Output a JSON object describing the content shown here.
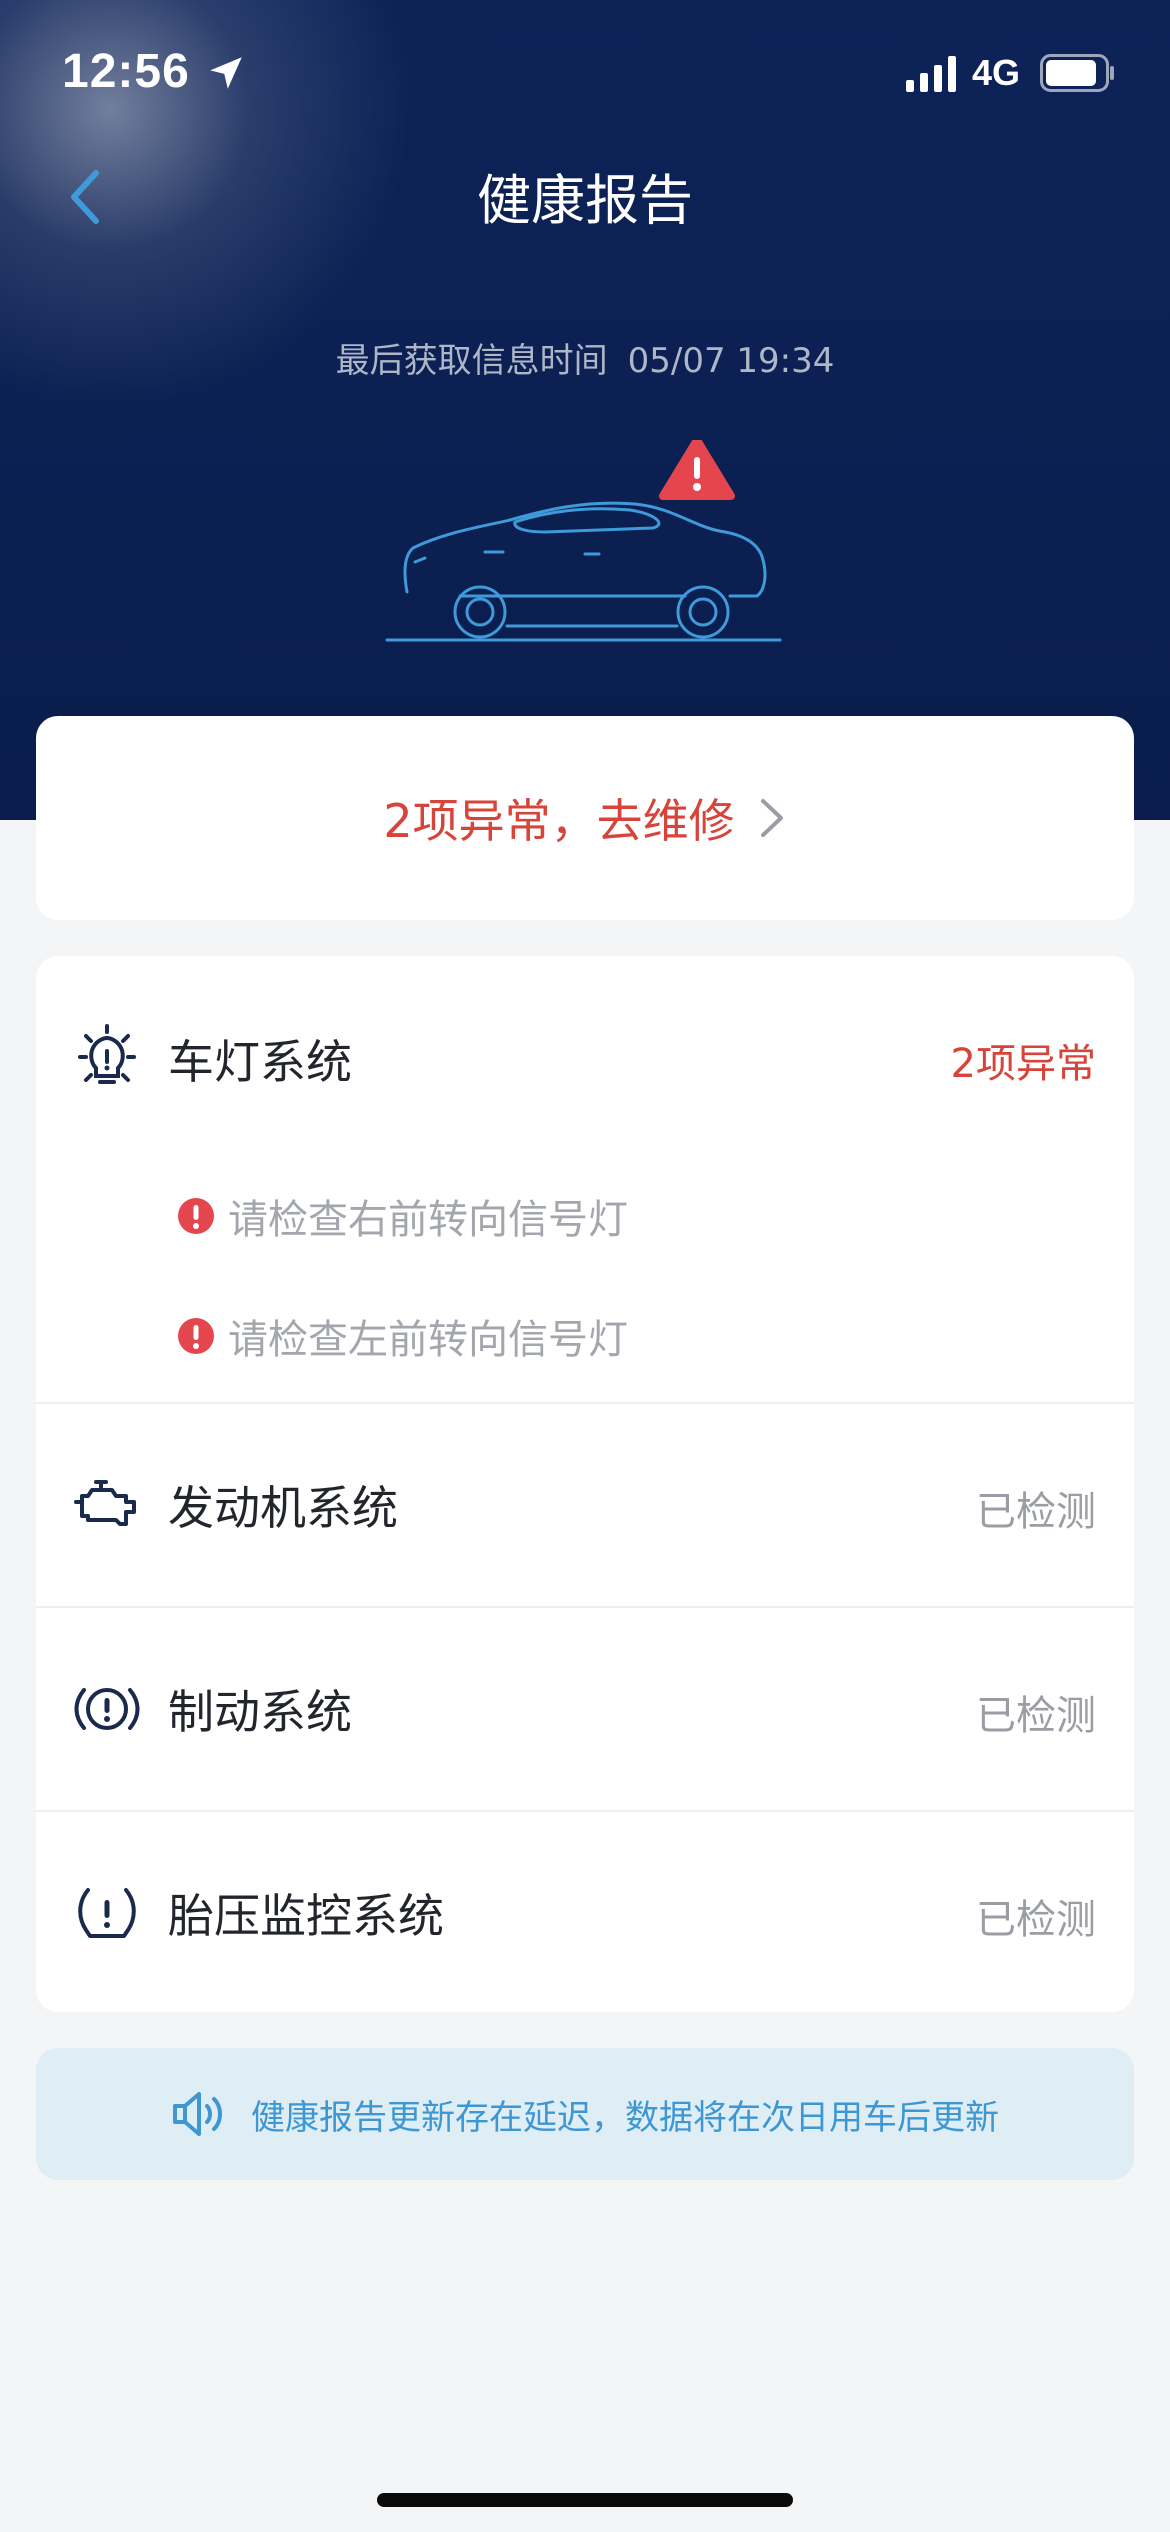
{
  "status_bar": {
    "time": "12:56",
    "network": "4G"
  },
  "nav": {
    "title": "健康报告"
  },
  "report": {
    "last_fetch_label": "最后获取信息时间",
    "last_fetch_time": "05/07 19:34"
  },
  "repair": {
    "text": "2项异常，去维修"
  },
  "systems": [
    {
      "name": "车灯系统",
      "status": "2项异常",
      "icon": "headlight-icon",
      "issues": [
        "请检查右前转向信号灯",
        "请检查左前转向信号灯"
      ]
    },
    {
      "name": "发动机系统",
      "status": "已检测",
      "icon": "engine-icon",
      "issues": []
    },
    {
      "name": "制动系统",
      "status": "已检测",
      "icon": "brake-icon",
      "issues": []
    },
    {
      "name": "胎压监控系统",
      "status": "已检测",
      "icon": "tire-pressure-icon",
      "issues": []
    }
  ],
  "notice": {
    "text": "健康报告更新存在延迟，数据将在次日用车后更新",
    "icon": "speaker-icon"
  },
  "colors": {
    "hero_bg": "#0a1d4d",
    "alert_red": "#d6443a",
    "accent_blue": "#3d97d3",
    "illustration_blue": "#3e9ad9"
  }
}
